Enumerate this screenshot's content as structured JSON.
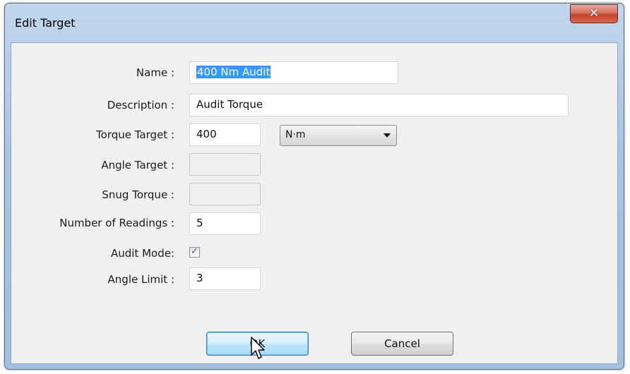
{
  "window": {
    "title": "Edit Target",
    "close_glyph": "✕"
  },
  "form": {
    "name": {
      "label": "Name :",
      "value": "400 Nm Audit"
    },
    "description": {
      "label": "Description :",
      "value": "Audit Torque"
    },
    "torque_target": {
      "label": "Torque Target :",
      "value": "400",
      "unit": "N·m"
    },
    "angle_target": {
      "label": "Angle Target :",
      "value": ""
    },
    "snug_torque": {
      "label": "Snug Torque :",
      "value": ""
    },
    "number_of_readings": {
      "label": "Number of Readings :",
      "value": "5"
    },
    "audit_mode": {
      "label": "Audit Mode:",
      "checked": true,
      "check_glyph": "✓"
    },
    "angle_limit": {
      "label": "Angle Limit :",
      "value": "3"
    }
  },
  "buttons": {
    "ok_label": "OK",
    "cancel_label": "Cancel"
  },
  "colors": {
    "selection": "#3399ff",
    "close_button": "#c5412c",
    "title_bar": "#aac5e3"
  },
  "icons": {
    "close": "close-icon",
    "dropdown": "chevron-down-icon",
    "check": "check-icon",
    "cursor": "mouse-pointer-icon"
  }
}
